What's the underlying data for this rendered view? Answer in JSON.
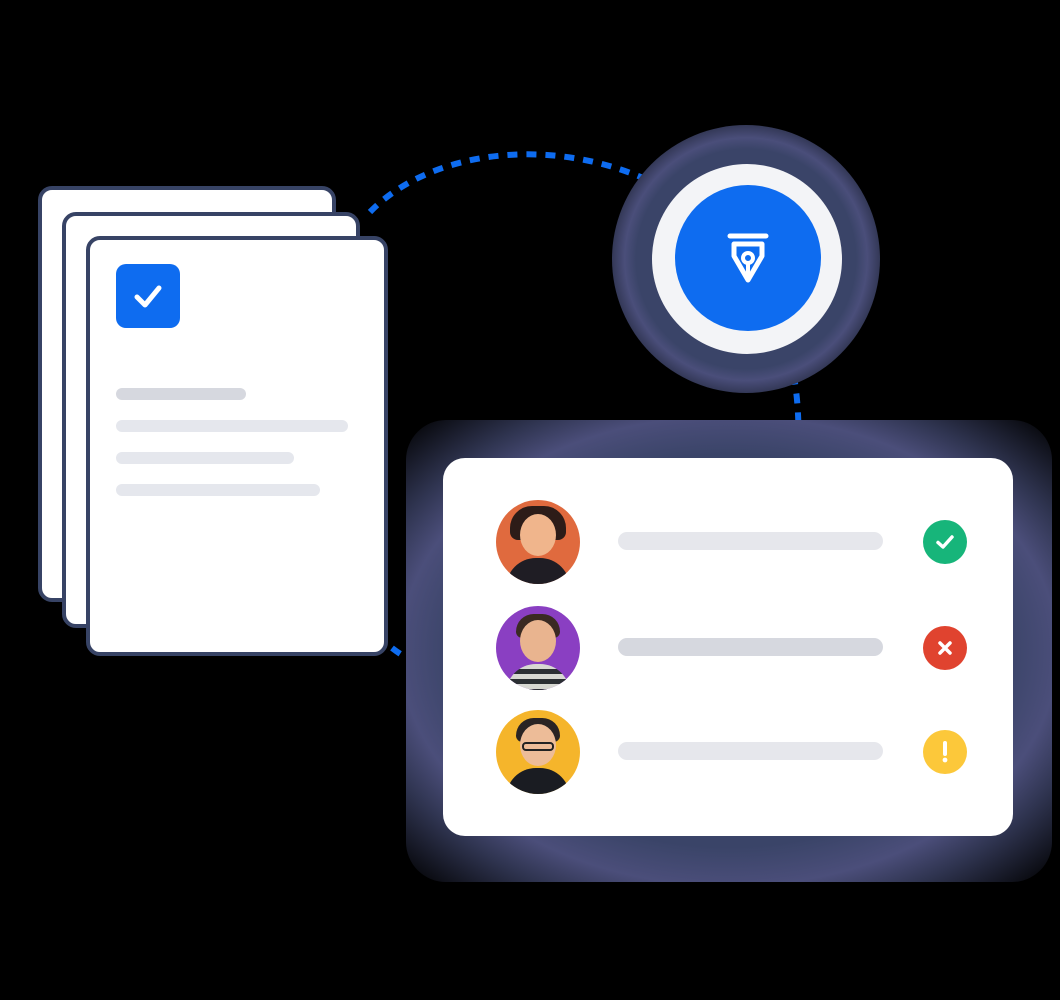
{
  "document": {
    "checkbox_icon": "checkmark-icon",
    "accent_color": "#0e6cf0",
    "placeholder_line_count": 4
  },
  "signature": {
    "icon": "fountain-pen-nib-icon",
    "color": "#0e6cf0"
  },
  "signers": [
    {
      "avatar": "avatar-woman-orange-bg",
      "status": "approved",
      "status_icon": "check-icon",
      "status_color": "#17b57a"
    },
    {
      "avatar": "avatar-man-purple-bg",
      "status": "declined",
      "status_icon": "x-icon",
      "status_color": "#e0432f"
    },
    {
      "avatar": "avatar-man-yellow-bg",
      "status": "pending",
      "status_icon": "exclamation-icon",
      "status_color": "#fcc83a"
    }
  ],
  "colors": {
    "connector": "#0e6cf0",
    "frame": "#374365",
    "placeholder": "#e5e7ed"
  }
}
